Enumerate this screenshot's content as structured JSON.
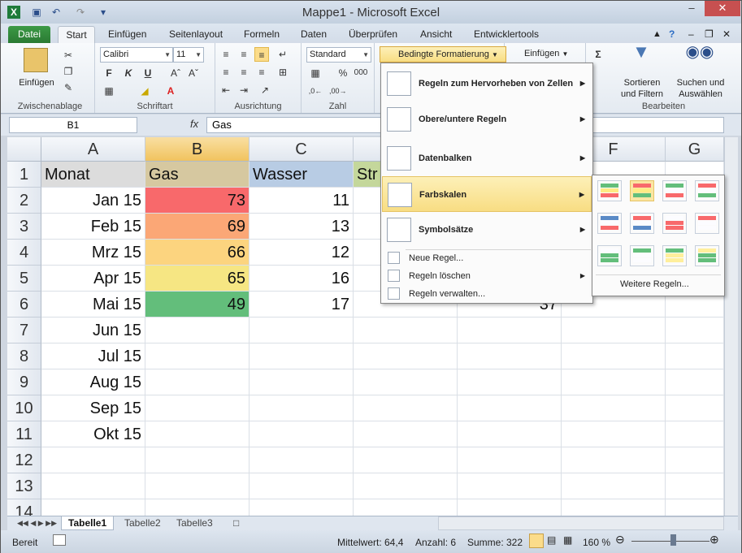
{
  "window": {
    "title": "Mappe1  -  Microsoft Excel"
  },
  "tabs": [
    "Datei",
    "Start",
    "Einfügen",
    "Seitenlayout",
    "Formeln",
    "Daten",
    "Überprüfen",
    "Ansicht",
    "Entwicklertools"
  ],
  "ribbon": {
    "clipboard": {
      "paste": "Einfügen",
      "label": "Zwischenablage"
    },
    "font": {
      "name": "Calibri",
      "size": "11",
      "bold": "F",
      "italic": "K",
      "underline": "U",
      "label": "Schriftart"
    },
    "alignment": {
      "label": "Ausrichtung"
    },
    "number": {
      "format": "Standard",
      "percent": "%",
      "thousands": "000",
      "label": "Zahl"
    },
    "styles": {
      "cond_format": "Bedingte Formatierung"
    },
    "cells": {
      "insert": "Einfügen"
    },
    "editing": {
      "sigma": "Σ",
      "sort": "Sortieren",
      "sort2": "und Filtern",
      "find": "Suchen und",
      "find2": "Auswählen",
      "label": "Bearbeiten"
    }
  },
  "formula_bar": {
    "name_box": "B1",
    "fx": "fx",
    "content": "Gas"
  },
  "columns": [
    "A",
    "B",
    "C",
    "D",
    "E",
    "F",
    "G"
  ],
  "rows": [
    "1",
    "2",
    "3",
    "4",
    "5",
    "6",
    "7",
    "8",
    "9",
    "10",
    "11",
    "12",
    "13",
    "14"
  ],
  "header_row": {
    "a": "Monat",
    "b": "Gas",
    "c": "Wasser",
    "d": "Str"
  },
  "cells": [
    {
      "month": "Jan 15",
      "gas": "73",
      "wasser": "11",
      "e": "",
      "gas_color": "#f8696b"
    },
    {
      "month": "Feb 15",
      "gas": "69",
      "wasser": "13",
      "e": "",
      "gas_color": "#fba776"
    },
    {
      "month": "Mrz 15",
      "gas": "66",
      "wasser": "12",
      "e": "",
      "gas_color": "#fcd47f"
    },
    {
      "month": "Apr 15",
      "gas": "65",
      "wasser": "16",
      "e": "",
      "gas_color": "#f6e683"
    },
    {
      "month": "Mai 15",
      "gas": "49",
      "wasser": "17",
      "e": "37",
      "gas_color": "#63be7b"
    },
    {
      "month": "Jun 15"
    },
    {
      "month": "Jul 15"
    },
    {
      "month": "Aug 15"
    },
    {
      "month": "Sep 15"
    },
    {
      "month": "Okt 15"
    }
  ],
  "menu": {
    "items": [
      "Regeln zum Hervorheben von Zellen",
      "Obere/untere Regeln",
      "Datenbalken",
      "Farbskalen",
      "Symbolsätze"
    ],
    "small": [
      "Neue Regel...",
      "Regeln löschen",
      "Regeln verwalten..."
    ]
  },
  "submenu": {
    "more": "Weitere Regeln..."
  },
  "sheets": [
    "Tabelle1",
    "Tabelle2",
    "Tabelle3"
  ],
  "status": {
    "ready": "Bereit",
    "avg": "Mittelwert: 64,4",
    "count": "Anzahl: 6",
    "sum": "Summe: 322",
    "zoom": "160 %"
  },
  "colors": {
    "selected_header": "#f1c35e",
    "header_gas": "#d6c8a0",
    "header_wasser": "#b8cce4",
    "header_month": "#dcdcdc",
    "header_str": "#c4d79b"
  }
}
